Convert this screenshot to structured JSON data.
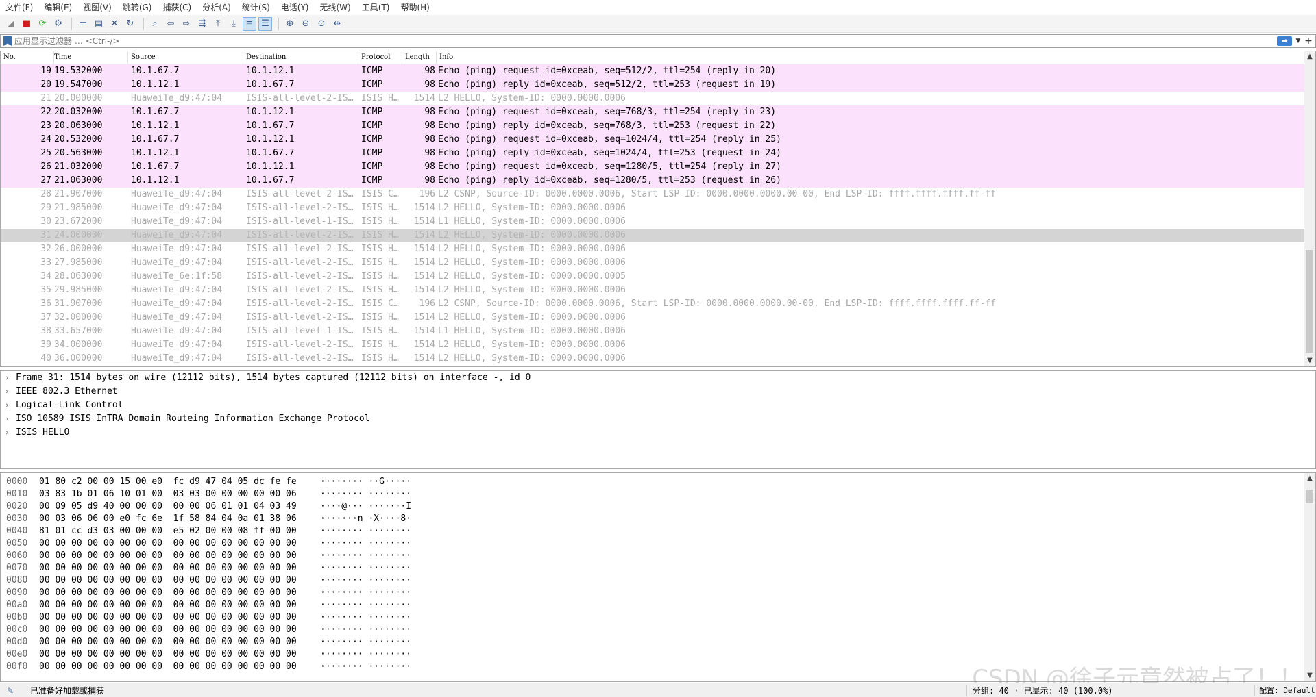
{
  "menu": [
    "文件(F)",
    "编辑(E)",
    "视图(V)",
    "跳转(G)",
    "捕获(C)",
    "分析(A)",
    "统计(S)",
    "电话(Y)",
    "无线(W)",
    "工具(T)",
    "帮助(H)"
  ],
  "toolbar": {
    "icons": [
      "shark-fin-start-icon",
      "stop-square-icon",
      "restart-capture-icon",
      "capture-options-icon",
      "open-file-icon",
      "save-file-icon",
      "close-file-icon",
      "reload-file-icon",
      "find-packet-icon",
      "go-back-icon",
      "go-forward-icon",
      "go-to-packet-icon",
      "go-first-icon",
      "go-last-icon",
      "auto-scroll-icon",
      "colorize-icon",
      "zoom-in-icon",
      "zoom-out-icon",
      "zoom-reset-icon",
      "resize-columns-icon"
    ]
  },
  "filter": {
    "placeholder": "应用显示过滤器 … <Ctrl-/>"
  },
  "columns": {
    "no": "No.",
    "time": "Time",
    "source": "Source",
    "destination": "Destination",
    "protocol": "Protocol",
    "length": "Length",
    "info": "Info"
  },
  "packets": [
    {
      "no": "19",
      "time": "19.532000",
      "src": "10.1.67.7",
      "dst": "10.1.12.1",
      "proto": "ICMP",
      "len": "98",
      "info": "Echo (ping) request  id=0xceab, seq=512/2, ttl=254 (reply in 20)",
      "kind": "icmp"
    },
    {
      "no": "20",
      "time": "19.547000",
      "src": "10.1.12.1",
      "dst": "10.1.67.7",
      "proto": "ICMP",
      "len": "98",
      "info": "Echo (ping) reply    id=0xceab, seq=512/2, ttl=253 (request in 19)",
      "kind": "icmp"
    },
    {
      "no": "21",
      "time": "20.000000",
      "src": "HuaweiTe_d9:47:04",
      "dst": "ISIS-all-level-2-IS…",
      "proto": "ISIS H…",
      "len": "1514",
      "info": "L2 HELLO, System-ID: 0000.0000.0006",
      "kind": "isis"
    },
    {
      "no": "22",
      "time": "20.032000",
      "src": "10.1.67.7",
      "dst": "10.1.12.1",
      "proto": "ICMP",
      "len": "98",
      "info": "Echo (ping) request  id=0xceab, seq=768/3, ttl=254 (reply in 23)",
      "kind": "icmp"
    },
    {
      "no": "23",
      "time": "20.063000",
      "src": "10.1.12.1",
      "dst": "10.1.67.7",
      "proto": "ICMP",
      "len": "98",
      "info": "Echo (ping) reply    id=0xceab, seq=768/3, ttl=253 (request in 22)",
      "kind": "icmp"
    },
    {
      "no": "24",
      "time": "20.532000",
      "src": "10.1.67.7",
      "dst": "10.1.12.1",
      "proto": "ICMP",
      "len": "98",
      "info": "Echo (ping) request  id=0xceab, seq=1024/4, ttl=254 (reply in 25)",
      "kind": "icmp"
    },
    {
      "no": "25",
      "time": "20.563000",
      "src": "10.1.12.1",
      "dst": "10.1.67.7",
      "proto": "ICMP",
      "len": "98",
      "info": "Echo (ping) reply    id=0xceab, seq=1024/4, ttl=253 (request in 24)",
      "kind": "icmp"
    },
    {
      "no": "26",
      "time": "21.032000",
      "src": "10.1.67.7",
      "dst": "10.1.12.1",
      "proto": "ICMP",
      "len": "98",
      "info": "Echo (ping) request  id=0xceab, seq=1280/5, ttl=254 (reply in 27)",
      "kind": "icmp"
    },
    {
      "no": "27",
      "time": "21.063000",
      "src": "10.1.12.1",
      "dst": "10.1.67.7",
      "proto": "ICMP",
      "len": "98",
      "info": "Echo (ping) reply    id=0xceab, seq=1280/5, ttl=253 (request in 26)",
      "kind": "icmp"
    },
    {
      "no": "28",
      "time": "21.907000",
      "src": "HuaweiTe_d9:47:04",
      "dst": "ISIS-all-level-2-IS…",
      "proto": "ISIS C…",
      "len": "196",
      "info": "L2 CSNP, Source-ID: 0000.0000.0006, Start LSP-ID: 0000.0000.0000.00-00, End LSP-ID: ffff.ffff.ffff.ff-ff",
      "kind": "isis"
    },
    {
      "no": "29",
      "time": "21.985000",
      "src": "HuaweiTe_d9:47:04",
      "dst": "ISIS-all-level-2-IS…",
      "proto": "ISIS H…",
      "len": "1514",
      "info": "L2 HELLO, System-ID: 0000.0000.0006",
      "kind": "isis"
    },
    {
      "no": "30",
      "time": "23.672000",
      "src": "HuaweiTe_d9:47:04",
      "dst": "ISIS-all-level-1-IS…",
      "proto": "ISIS H…",
      "len": "1514",
      "info": "L1 HELLO, System-ID: 0000.0000.0006",
      "kind": "isis"
    },
    {
      "no": "31",
      "time": "24.000000",
      "src": "HuaweiTe_d9:47:04",
      "dst": "ISIS-all-level-2-IS…",
      "proto": "ISIS H…",
      "len": "1514",
      "info": "L2 HELLO, System-ID: 0000.0000.0006",
      "kind": "sel"
    },
    {
      "no": "32",
      "time": "26.000000",
      "src": "HuaweiTe_d9:47:04",
      "dst": "ISIS-all-level-2-IS…",
      "proto": "ISIS H…",
      "len": "1514",
      "info": "L2 HELLO, System-ID: 0000.0000.0006",
      "kind": "isis"
    },
    {
      "no": "33",
      "time": "27.985000",
      "src": "HuaweiTe_d9:47:04",
      "dst": "ISIS-all-level-2-IS…",
      "proto": "ISIS H…",
      "len": "1514",
      "info": "L2 HELLO, System-ID: 0000.0000.0006",
      "kind": "isis"
    },
    {
      "no": "34",
      "time": "28.063000",
      "src": "HuaweiTe_6e:1f:58",
      "dst": "ISIS-all-level-2-IS…",
      "proto": "ISIS H…",
      "len": "1514",
      "info": "L2 HELLO, System-ID: 0000.0000.0005",
      "kind": "isis"
    },
    {
      "no": "35",
      "time": "29.985000",
      "src": "HuaweiTe_d9:47:04",
      "dst": "ISIS-all-level-2-IS…",
      "proto": "ISIS H…",
      "len": "1514",
      "info": "L2 HELLO, System-ID: 0000.0000.0006",
      "kind": "isis"
    },
    {
      "no": "36",
      "time": "31.907000",
      "src": "HuaweiTe_d9:47:04",
      "dst": "ISIS-all-level-2-IS…",
      "proto": "ISIS C…",
      "len": "196",
      "info": "L2 CSNP, Source-ID: 0000.0000.0006, Start LSP-ID: 0000.0000.0000.00-00, End LSP-ID: ffff.ffff.ffff.ff-ff",
      "kind": "isis"
    },
    {
      "no": "37",
      "time": "32.000000",
      "src": "HuaweiTe_d9:47:04",
      "dst": "ISIS-all-level-2-IS…",
      "proto": "ISIS H…",
      "len": "1514",
      "info": "L2 HELLO, System-ID: 0000.0000.0006",
      "kind": "isis"
    },
    {
      "no": "38",
      "time": "33.657000",
      "src": "HuaweiTe_d9:47:04",
      "dst": "ISIS-all-level-1-IS…",
      "proto": "ISIS H…",
      "len": "1514",
      "info": "L1 HELLO, System-ID: 0000.0000.0006",
      "kind": "isis"
    },
    {
      "no": "39",
      "time": "34.000000",
      "src": "HuaweiTe_d9:47:04",
      "dst": "ISIS-all-level-2-IS…",
      "proto": "ISIS H…",
      "len": "1514",
      "info": "L2 HELLO, System-ID: 0000.0000.0006",
      "kind": "isis"
    },
    {
      "no": "40",
      "time": "36.000000",
      "src": "HuaweiTe_d9:47:04",
      "dst": "ISIS-all-level-2-IS…",
      "proto": "ISIS H…",
      "len": "1514",
      "info": "L2 HELLO, System-ID: 0000.0000.0006",
      "kind": "isis"
    }
  ],
  "details": [
    "Frame 31: 1514 bytes on wire (12112 bits), 1514 bytes captured (12112 bits) on interface -, id 0",
    "IEEE 802.3 Ethernet",
    "Logical-Link Control",
    "ISO 10589 ISIS InTRA Domain Routeing Information Exchange Protocol",
    "ISIS HELLO"
  ],
  "bytes": [
    {
      "off": "0000",
      "hex": "01 80 c2 00 00 15 00 e0  fc d9 47 04 05 dc fe fe",
      "ascii": "········ ··G·····"
    },
    {
      "off": "0010",
      "hex": "03 83 1b 01 06 10 01 00  03 03 00 00 00 00 00 06",
      "ascii": "········ ········"
    },
    {
      "off": "0020",
      "hex": "00 09 05 d9 40 00 00 00  00 00 06 01 01 04 03 49",
      "ascii": "····@··· ·······I"
    },
    {
      "off": "0030",
      "hex": "00 03 06 06 00 e0 fc 6e  1f 58 84 04 0a 01 38 06",
      "ascii": "·······n ·X····8·"
    },
    {
      "off": "0040",
      "hex": "81 01 cc d3 03 00 00 00  e5 02 00 00 08 ff 00 00",
      "ascii": "········ ········"
    },
    {
      "off": "0050",
      "hex": "00 00 00 00 00 00 00 00  00 00 00 00 00 00 00 00",
      "ascii": "········ ········"
    },
    {
      "off": "0060",
      "hex": "00 00 00 00 00 00 00 00  00 00 00 00 00 00 00 00",
      "ascii": "········ ········"
    },
    {
      "off": "0070",
      "hex": "00 00 00 00 00 00 00 00  00 00 00 00 00 00 00 00",
      "ascii": "········ ········"
    },
    {
      "off": "0080",
      "hex": "00 00 00 00 00 00 00 00  00 00 00 00 00 00 00 00",
      "ascii": "········ ········"
    },
    {
      "off": "0090",
      "hex": "00 00 00 00 00 00 00 00  00 00 00 00 00 00 00 00",
      "ascii": "········ ········"
    },
    {
      "off": "00a0",
      "hex": "00 00 00 00 00 00 00 00  00 00 00 00 00 00 00 00",
      "ascii": "········ ········"
    },
    {
      "off": "00b0",
      "hex": "00 00 00 00 00 00 00 00  00 00 00 00 00 00 00 00",
      "ascii": "········ ········"
    },
    {
      "off": "00c0",
      "hex": "00 00 00 00 00 00 00 00  00 00 00 00 00 00 00 00",
      "ascii": "········ ········"
    },
    {
      "off": "00d0",
      "hex": "00 00 00 00 00 00 00 00  00 00 00 00 00 00 00 00",
      "ascii": "········ ········"
    },
    {
      "off": "00e0",
      "hex": "00 00 00 00 00 00 00 00  00 00 00 00 00 00 00 00",
      "ascii": "········ ········"
    },
    {
      "off": "00f0",
      "hex": "00 00 00 00 00 00 00 00  00 00 00 00 00 00 00 00",
      "ascii": "········ ········"
    }
  ],
  "status": {
    "ready": "已准备好加载或捕获",
    "counts": "分组: 40 · 已显示: 40 (100.0%)",
    "profile": "配置: Default"
  },
  "watermark": "CSDN @徐子元竟然被占了！！",
  "colors": {
    "icmp_row": "#fbe1fb",
    "isis_text": "#a9a9a9",
    "selected_row": "#d4d4d4"
  }
}
